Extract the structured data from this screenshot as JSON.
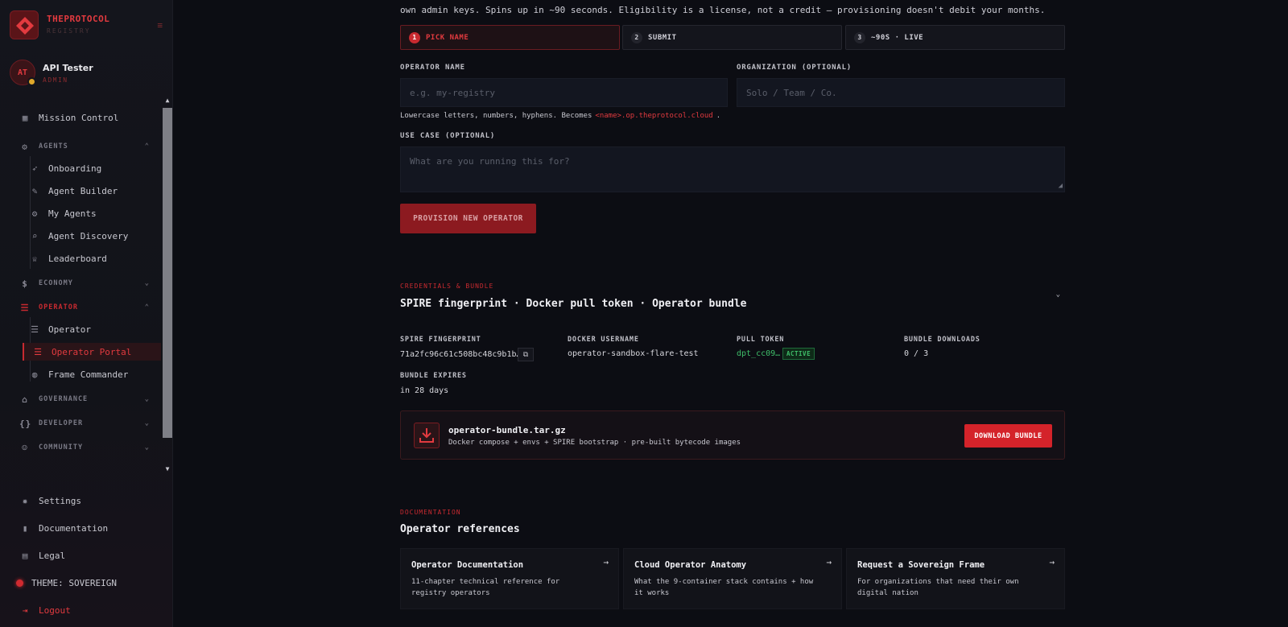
{
  "brand": {
    "name": "THEPROTOCOL",
    "sub": "REGISTRY"
  },
  "user": {
    "initials": "AT",
    "name": "API Tester",
    "role": "ADMIN"
  },
  "nav": {
    "mission_control": "Mission Control",
    "agents": "AGENTS",
    "onboarding": "Onboarding",
    "agent_builder": "Agent Builder",
    "my_agents": "My Agents",
    "agent_discovery": "Agent Discovery",
    "leaderboard": "Leaderboard",
    "economy": "ECONOMY",
    "operator_group": "OPERATOR",
    "operator": "Operator",
    "operator_portal": "Operator Portal",
    "frame_commander": "Frame Commander",
    "governance": "GOVERNANCE",
    "developer": "DEVELOPER",
    "community": "COMMUNITY"
  },
  "bottom_nav": {
    "settings": "Settings",
    "documentation": "Documentation",
    "legal": "Legal",
    "theme": "THEME: SOVEREIGN",
    "logout": "Logout"
  },
  "intro": "own admin keys. Spins up in ~90 seconds. Eligibility is a license, not a credit — provisioning doesn't debit your months.",
  "steps": [
    {
      "num": "1",
      "label": "PICK NAME"
    },
    {
      "num": "2",
      "label": "SUBMIT"
    },
    {
      "num": "3",
      "label": "~90S · LIVE"
    }
  ],
  "form": {
    "operator_name_label": "OPERATOR NAME",
    "operator_name_placeholder": "e.g. my-registry",
    "org_label": "ORGANIZATION (OPTIONAL)",
    "org_placeholder": "Solo / Team / Co.",
    "hint_prefix": "Lowercase letters, numbers, hyphens. Becomes",
    "hint_code": "<name>.op.theprotocol.cloud",
    "hint_suffix": ".",
    "use_case_label": "USE CASE (OPTIONAL)",
    "use_case_placeholder": "What are you running this for?",
    "provision_button": "PROVISION NEW OPERATOR"
  },
  "credentials": {
    "kicker": "CREDENTIALS & BUNDLE",
    "title": "SPIRE fingerprint · Docker pull token · Operator bundle",
    "spire_label": "SPIRE FINGERPRINT",
    "spire_value": "71a2fc96c61c508bc48c9b1b…",
    "docker_label": "DOCKER USERNAME",
    "docker_value": "operator-sandbox-flare-test",
    "token_label": "PULL TOKEN",
    "token_value": "dpt_cc09…",
    "token_status": "ACTIVE",
    "downloads_label": "BUNDLE DOWNLOADS",
    "downloads_value": "0 / 3",
    "expires_label": "BUNDLE EXPIRES",
    "expires_value": "in 28 days"
  },
  "bundle": {
    "name": "operator-bundle.tar.gz",
    "desc": "Docker compose + envs + SPIRE bootstrap · pre-built bytecode images",
    "download_button": "DOWNLOAD BUNDLE"
  },
  "docs": {
    "kicker": "DOCUMENTATION",
    "title": "Operator references",
    "cards": [
      {
        "title": "Operator Documentation",
        "desc": "11-chapter technical reference for registry operators"
      },
      {
        "title": "Cloud Operator Anatomy",
        "desc": "What the 9-container stack contains + how it works"
      },
      {
        "title": "Request a Sovereign Frame",
        "desc": "For organizations that need their own digital nation"
      }
    ]
  },
  "colors": {
    "accent": "#e23a3f",
    "success": "#3fbf6a",
    "background": "#0c0d13"
  },
  "icons": [
    "grid-icon",
    "robot-icon",
    "rocket-icon",
    "wrench-icon",
    "search-icon",
    "trophy-icon",
    "dollar-icon",
    "server-icon",
    "globe-icon",
    "copy-icon",
    "download-icon",
    "arrow-right-icon",
    "gear-icon",
    "book-icon",
    "legal-icon",
    "logout-icon"
  ]
}
